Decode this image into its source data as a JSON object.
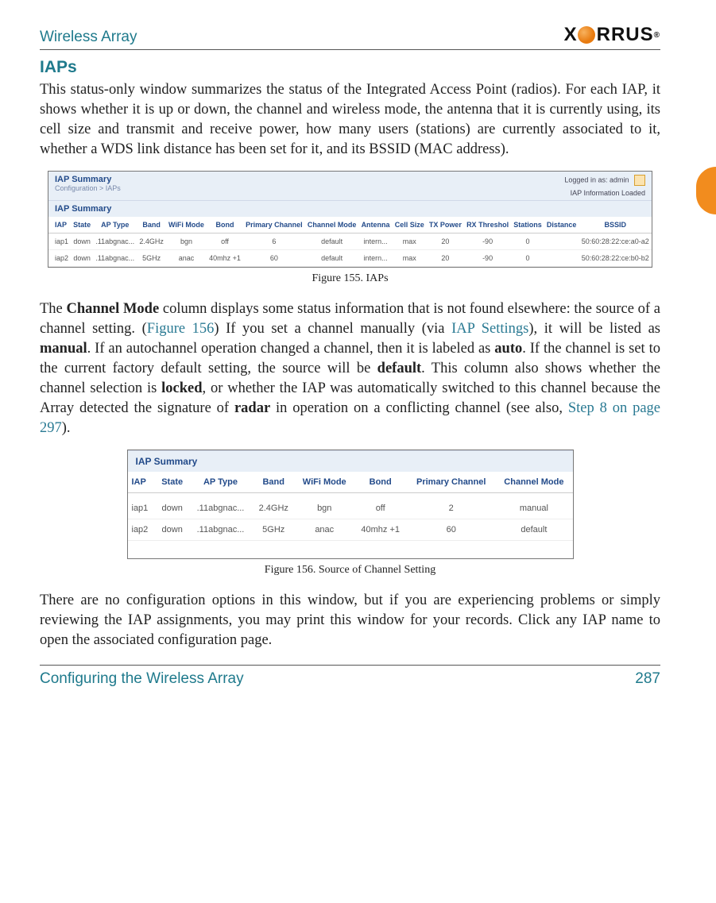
{
  "header": {
    "title": "Wireless Array",
    "logo_prefix": "X",
    "logo_suffix": "RRUS"
  },
  "section": {
    "heading": "IAPs"
  },
  "p1": "This status-only window summarizes the status of the Integrated Access Point (radios). For each IAP, it shows whether it is up or down, the channel and wireless mode, the antenna that it is currently using, its cell size and transmit and receive power, how many users (stations) are currently associated to it, whether a WDS link distance has been set for it, and its BSSID (MAC address).",
  "fig155": {
    "title": "IAP Summary",
    "breadcrumb": "Configuration > IAPs",
    "logged_label": "Logged in as:",
    "logged_user": "admin",
    "info_loaded": "IAP Information Loaded",
    "summary_label": "IAP Summary",
    "cols": [
      "IAP",
      "State",
      "AP Type",
      "Band",
      "WiFi Mode",
      "Bond",
      "Primary Channel",
      "Channel Mode",
      "Antenna",
      "Cell Size",
      "TX Power",
      "RX Threshol",
      "Stations",
      "Distance",
      "BSSID"
    ],
    "rows": [
      [
        "iap1",
        "down",
        ".11abgnac...",
        "2.4GHz",
        "bgn",
        "off",
        "6",
        "default",
        "intern...",
        "max",
        "20",
        "-90",
        "0",
        "",
        "50:60:28:22:ce:a0-a2"
      ],
      [
        "iap2",
        "down",
        ".11abgnac...",
        "5GHz",
        "anac",
        "40mhz +1",
        "60",
        "default",
        "intern...",
        "max",
        "20",
        "-90",
        "0",
        "",
        "50:60:28:22:ce:b0-b2"
      ]
    ],
    "caption": "Figure 155. IAPs"
  },
  "p2": {
    "t1": "The ",
    "b1": "Channel Mode",
    "t2": " column displays some status information that is not found elsewhere: the source of a channel setting. (",
    "l1": "Figure 156",
    "t3": ") If you set a channel manually (via ",
    "l2": "IAP Settings",
    "t4": "), it will be listed as ",
    "b2": "manual",
    "t5": ". If an autochannel operation changed a channel, then it is labeled as ",
    "b3": "auto",
    "t6": ". If the channel is set to the current factory default setting, the source will be ",
    "b4": "default",
    "t7": ". This column also shows whether the channel selection is ",
    "b5": "locked",
    "t8": ", or whether the IAP was automatically switched to this channel because the Array detected the signature of ",
    "b6": "radar",
    "t9": " in operation on a conflicting channel (see also, ",
    "l3": "Step 8 on page 297",
    "t10": ")."
  },
  "fig156": {
    "summary_label": "IAP Summary",
    "cols": [
      "IAP",
      "State",
      "AP Type",
      "Band",
      "WiFi Mode",
      "Bond",
      "Primary Channel",
      "Channel Mode"
    ],
    "rows": [
      [
        "iap1",
        "down",
        ".11abgnac...",
        "2.4GHz",
        "bgn",
        "off",
        "2",
        "manual"
      ],
      [
        "iap2",
        "down",
        ".11abgnac...",
        "5GHz",
        "anac",
        "40mhz +1",
        "60",
        "default"
      ]
    ],
    "caption": "Figure 156. Source of Channel Setting"
  },
  "p3": "There are no configuration options in this window, but if you are experiencing problems or simply reviewing the IAP assignments, you may print this window for your records. Click any IAP name to open the associated configuration page.",
  "footer": {
    "left": "Configuring the Wireless Array",
    "right": "287"
  }
}
